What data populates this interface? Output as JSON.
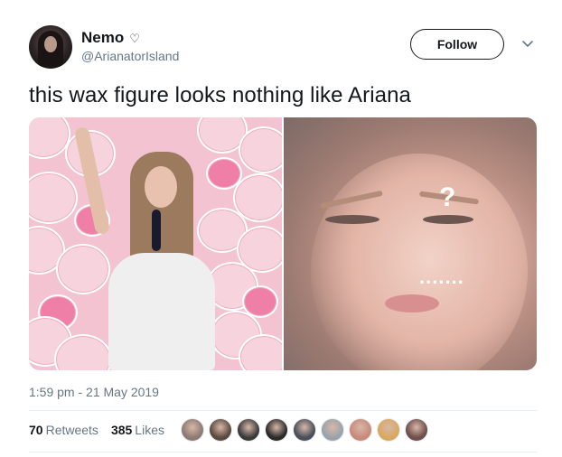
{
  "user": {
    "display_name": "Nemo",
    "name_icon": "heart-outline-icon",
    "handle": "@ArianatorIsland"
  },
  "follow_label": "Follow",
  "tweet": {
    "text": "this wax figure looks nothing like Ariana",
    "timestamp": "1:59 pm - 21 May 2019"
  },
  "media": {
    "annotations": {
      "question_mark": "?",
      "dots": "......."
    }
  },
  "stats": {
    "retweets_count": "70",
    "retweets_label": "Retweets",
    "likes_count": "385",
    "likes_label": "Likes"
  },
  "likers": [
    {
      "color": "#8d7b73"
    },
    {
      "color": "#5a4a40"
    },
    {
      "color": "#3a3a3a"
    },
    {
      "color": "#2a2a2a"
    },
    {
      "color": "#4a4f5a"
    },
    {
      "color": "#9aa3ad"
    },
    {
      "color": "#c98a7a"
    },
    {
      "color": "#d9a860"
    },
    {
      "color": "#6e4f4a"
    }
  ]
}
